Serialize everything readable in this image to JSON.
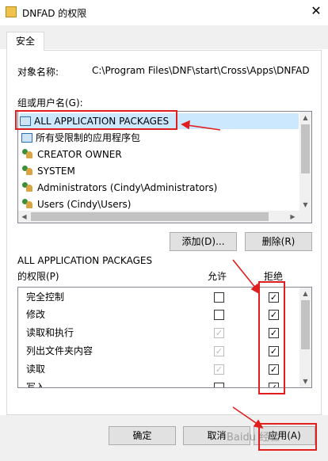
{
  "window": {
    "title": "DNFAD 的权限",
    "close_glyph": "✕"
  },
  "tabs": [
    {
      "label": "安全"
    }
  ],
  "object_name": {
    "label": "对象名称:",
    "value": "C:\\Program Files\\DNF\\start\\Cross\\Apps\\DNFAD"
  },
  "groups": {
    "label": "组或用户名(G):",
    "items": [
      {
        "label": "ALL APPLICATION PACKAGES",
        "icon": "package-icon"
      },
      {
        "label": "所有受限制的应用程序包",
        "icon": "package-icon"
      },
      {
        "label": "CREATOR OWNER",
        "icon": "users-icon"
      },
      {
        "label": "SYSTEM",
        "icon": "users-icon"
      },
      {
        "label": "Administrators (Cindy\\Administrators)",
        "icon": "users-icon"
      },
      {
        "label": "Users (Cindy\\Users)",
        "icon": "users-icon"
      }
    ]
  },
  "buttons": {
    "add": "添加(D)...",
    "remove": "删除(R)",
    "ok": "确定",
    "cancel": "取消",
    "apply": "应用(A)"
  },
  "permissions": {
    "title_line1": "ALL APPLICATION PACKAGES",
    "title_line2": "的权限(P)",
    "allow_header": "允许",
    "deny_header": "拒绝",
    "rows": [
      {
        "label": "完全控制",
        "allow": "",
        "deny": "✓"
      },
      {
        "label": "修改",
        "allow": "",
        "deny": "✓"
      },
      {
        "label": "读取和执行",
        "allow": "✓",
        "deny": "✓"
      },
      {
        "label": "列出文件夹内容",
        "allow": "✓",
        "deny": "✓"
      },
      {
        "label": "读取",
        "allow": "✓",
        "deny": "✓"
      },
      {
        "label": "写入",
        "allow": "",
        "deny": "✓"
      }
    ]
  },
  "watermark": "Baidu 经验",
  "colors": {
    "annotation_red": "#e01e1e",
    "selection": "#cce8ff"
  }
}
